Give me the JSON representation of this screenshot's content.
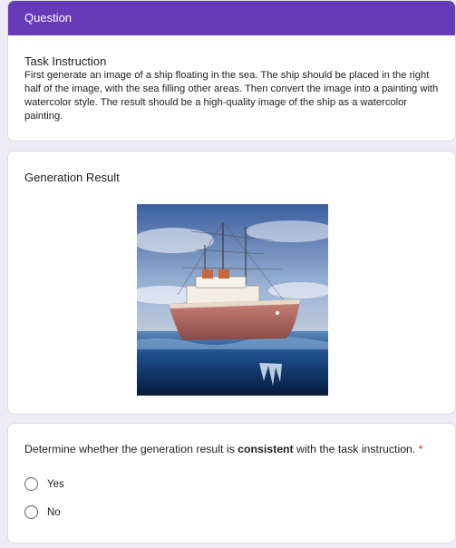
{
  "question_card": {
    "header": "Question",
    "task_title": "Task Instruction",
    "task_text": "First generate an image of a ship floating in the sea. The ship should be placed in the right half of the image, with the sea filling other areas. Then convert the image into a painting with watercolor style. The result should be a high-quality image of the ship as a watercolor painting."
  },
  "generation_card": {
    "title": "Generation Result"
  },
  "judge_card": {
    "question_prefix": "Determine whether the generation result is ",
    "question_bold": "consistent",
    "question_suffix": " with the task instruction.",
    "required_mark": "*",
    "options": [
      {
        "label": "Yes",
        "selected": false
      },
      {
        "label": "No",
        "selected": false
      }
    ]
  },
  "colors": {
    "header": "#673ab7",
    "background": "#f0ebf8",
    "required": "#d93025"
  }
}
